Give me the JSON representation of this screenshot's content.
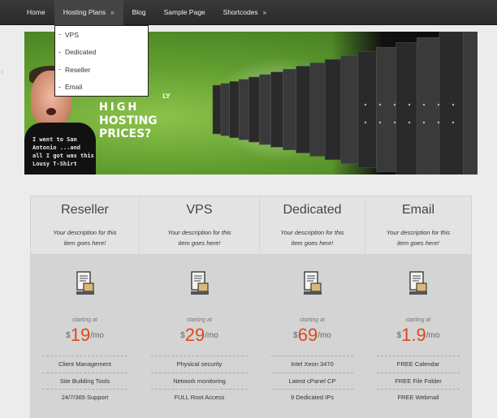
{
  "nav": {
    "items": [
      {
        "label": "Home",
        "has_submenu": false
      },
      {
        "label": "Hosting Plans",
        "has_submenu": true
      },
      {
        "label": "Blog",
        "has_submenu": false
      },
      {
        "label": "Sample Page",
        "has_submenu": false
      },
      {
        "label": "Shortcodes",
        "has_submenu": true
      }
    ],
    "submenu_arrow": "»",
    "dropdown": [
      "VPS",
      "Dedicated",
      "Reseller",
      "Email"
    ]
  },
  "banner": {
    "small_word": "LY",
    "headline_1": "HIGH",
    "headline_2": "HOSTING",
    "headline_3": "PRICES?",
    "shirt_lines": [
      "I went to San",
      "Antonio ...and",
      "all I got was this",
      "Lousy T-Shirt"
    ]
  },
  "plans": [
    {
      "name": "Reseller",
      "desc_1": "Your description for this",
      "desc_2": "item goes here!",
      "starting": "starting at",
      "currency": "$",
      "price": "19",
      "period": "/mo",
      "features": [
        "Client Management",
        "Site Building Tools",
        "24/7/365 Support"
      ]
    },
    {
      "name": "VPS",
      "desc_1": "Your description for this",
      "desc_2": "item goes here!",
      "starting": "starting at",
      "currency": "$",
      "price": "29",
      "period": "/mo",
      "features": [
        "Physical security",
        "Network monitoring",
        "FULL Root Access"
      ]
    },
    {
      "name": "Dedicated",
      "desc_1": "Your description for this",
      "desc_2": "item goes here!",
      "starting": "starting at",
      "currency": "$",
      "price": "69",
      "period": "/mo",
      "features": [
        "Intel Xeon 3470",
        "Latest cPanel CP",
        "9 Dedicated IPs"
      ]
    },
    {
      "name": "Email",
      "desc_1": "Your description for this",
      "desc_2": "item goes here!",
      "starting": "starting at",
      "currency": "$",
      "price": "1.9",
      "period": "/mo",
      "features": [
        "FREE Calendar",
        "FREE File Folder",
        "FREE Webmail"
      ]
    }
  ],
  "colors": {
    "accent": "#e0481a",
    "nav_bg": "#2e2e2e",
    "banner_green": "#5f9c2e"
  }
}
